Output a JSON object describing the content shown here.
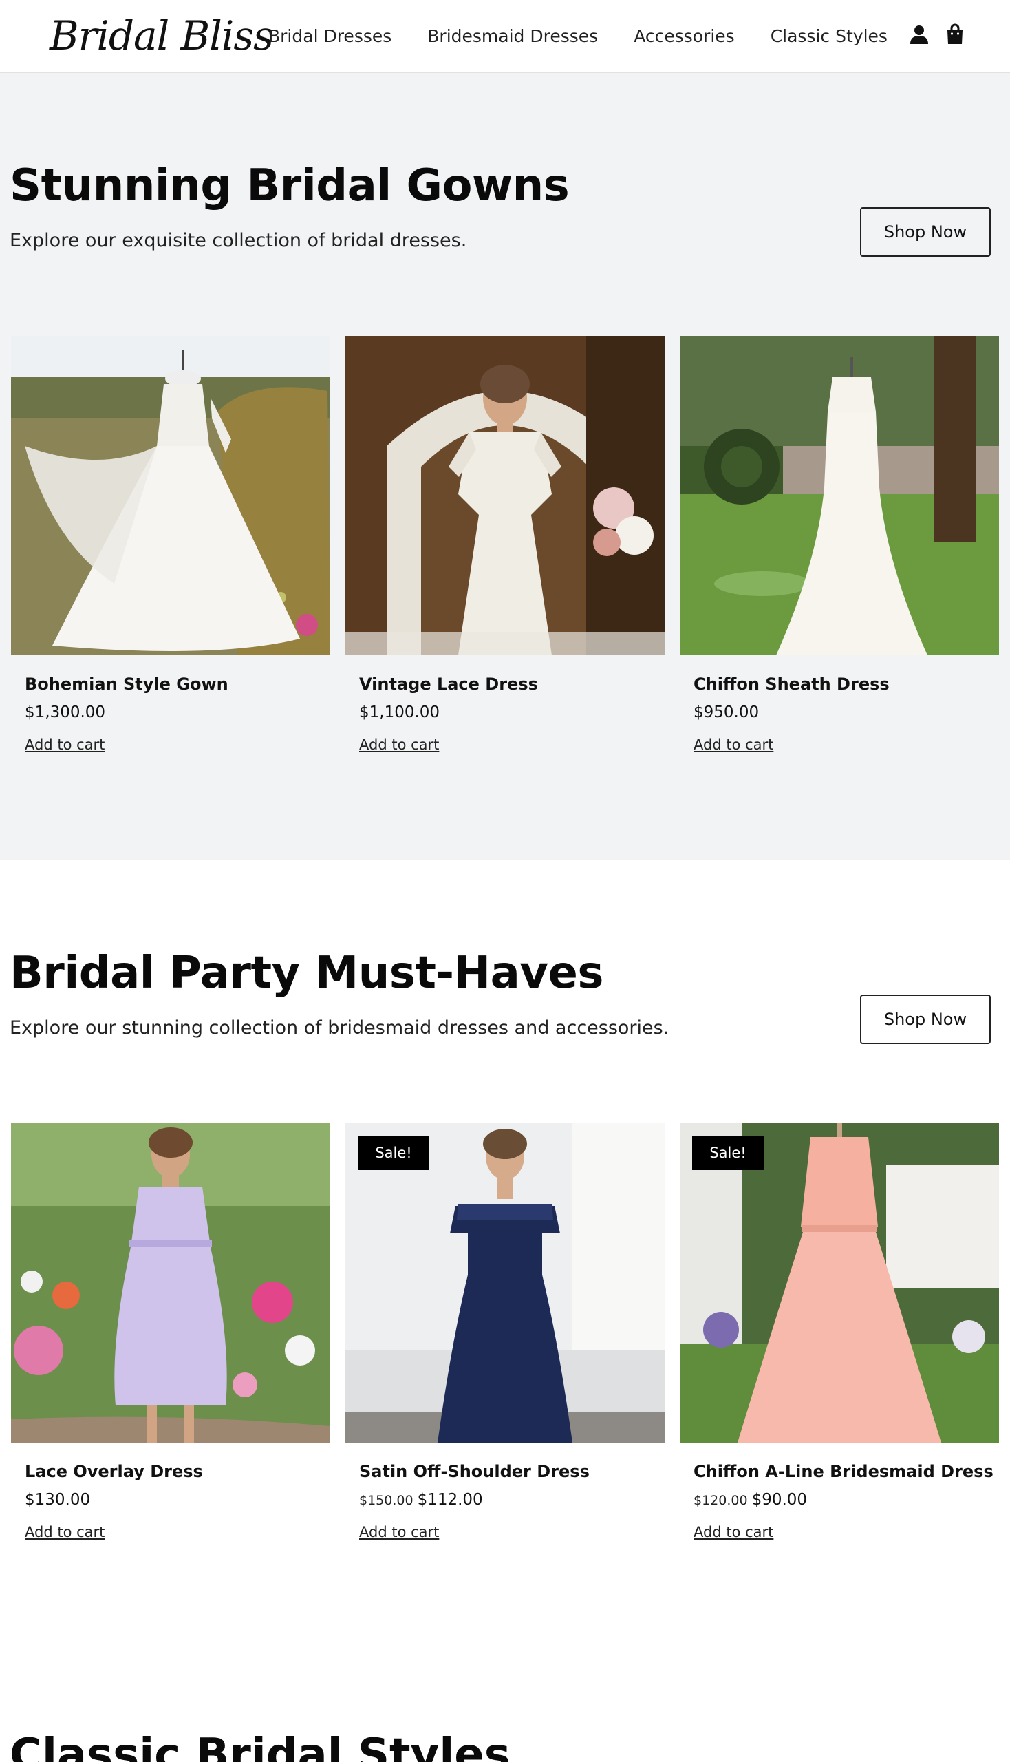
{
  "brand": {
    "logo": "Bridal Bliss"
  },
  "nav": {
    "items": [
      "Bridal Dresses",
      "Bridesmaid Dresses",
      "Accessories",
      "Classic Styles"
    ]
  },
  "header_icons": [
    "user-icon",
    "shopping-bag-icon"
  ],
  "sections": [
    {
      "title": "Stunning Bridal Gowns",
      "subtitle": "Explore our exquisite collection of bridal dresses.",
      "button": "Shop Now",
      "products": [
        {
          "name": "Bohemian Style Gown",
          "price": "$1,300.00",
          "cta": "Add to cart",
          "sale": false
        },
        {
          "name": "Vintage Lace Dress",
          "price": "$1,100.00",
          "cta": "Add to cart",
          "sale": false
        },
        {
          "name": "Chiffon Sheath Dress",
          "price": "$950.00",
          "cta": "Add to cart",
          "sale": false
        }
      ]
    },
    {
      "title": "Bridal Party Must-Haves",
      "subtitle": "Explore our stunning collection of bridesmaid dresses and accessories.",
      "button": "Shop Now",
      "products": [
        {
          "name": "Lace Overlay Dress",
          "price": "$130.00",
          "cta": "Add to cart",
          "sale": false
        },
        {
          "name": "Satin Off-Shoulder Dress",
          "old_price": "$150.00",
          "price": "$112.00",
          "cta": "Add to cart",
          "sale": true,
          "badge": "Sale!"
        },
        {
          "name": "Chiffon A-Line Bridesmaid Dress",
          "old_price": "$120.00",
          "price": "$90.00",
          "cta": "Add to cart",
          "sale": true,
          "badge": "Sale!"
        }
      ]
    },
    {
      "title": "Classic Bridal Styles"
    }
  ],
  "colors": {
    "section_bg": "#f2f3f5",
    "page_bg": "#ffffff",
    "badge_bg": "#000000",
    "text": "#111111"
  }
}
